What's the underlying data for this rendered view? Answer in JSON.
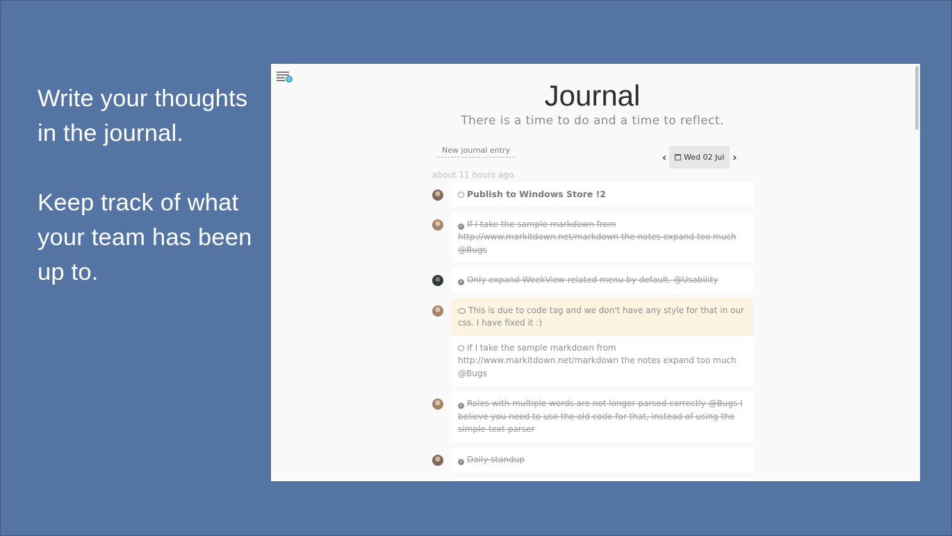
{
  "slide": {
    "paragraph1": "Write your thoughts in the journal.",
    "paragraph2": "Keep track of what your team has been up to."
  },
  "app": {
    "badge_count": "0",
    "title": "Journal",
    "subtitle": "There is a time to do and a time to reflect.",
    "new_entry_placeholder": "New journal entry",
    "date_nav": {
      "prev": "‹",
      "next": "›",
      "date_label": "Wed 02 Jul"
    },
    "time_ago": "about 11 hours ago",
    "entries": [
      {
        "status": "open",
        "text": "Publish to Windows Store !2"
      },
      {
        "status": "done",
        "text": "If I take the sample markdown from http://www.markitdown.net/markdown the notes expand too much @Bugs"
      },
      {
        "status": "done",
        "text": "Only expand WeekView related menu by default. @Usability"
      },
      {
        "status": "comment",
        "text": "This is due to code tag and we don't have any style for that in our css. I have fixed it :)"
      },
      {
        "status": "open",
        "text": "If I take the sample markdown from http://www.markitdown.net/markdown the notes expand too much @Bugs"
      },
      {
        "status": "done",
        "text": "Roles with multiple words are not longer parsed correctly @Bugs I believe you need to use the old code for that, instead of using the simple-text-parser"
      },
      {
        "status": "done",
        "text": "Daily standup"
      }
    ]
  }
}
